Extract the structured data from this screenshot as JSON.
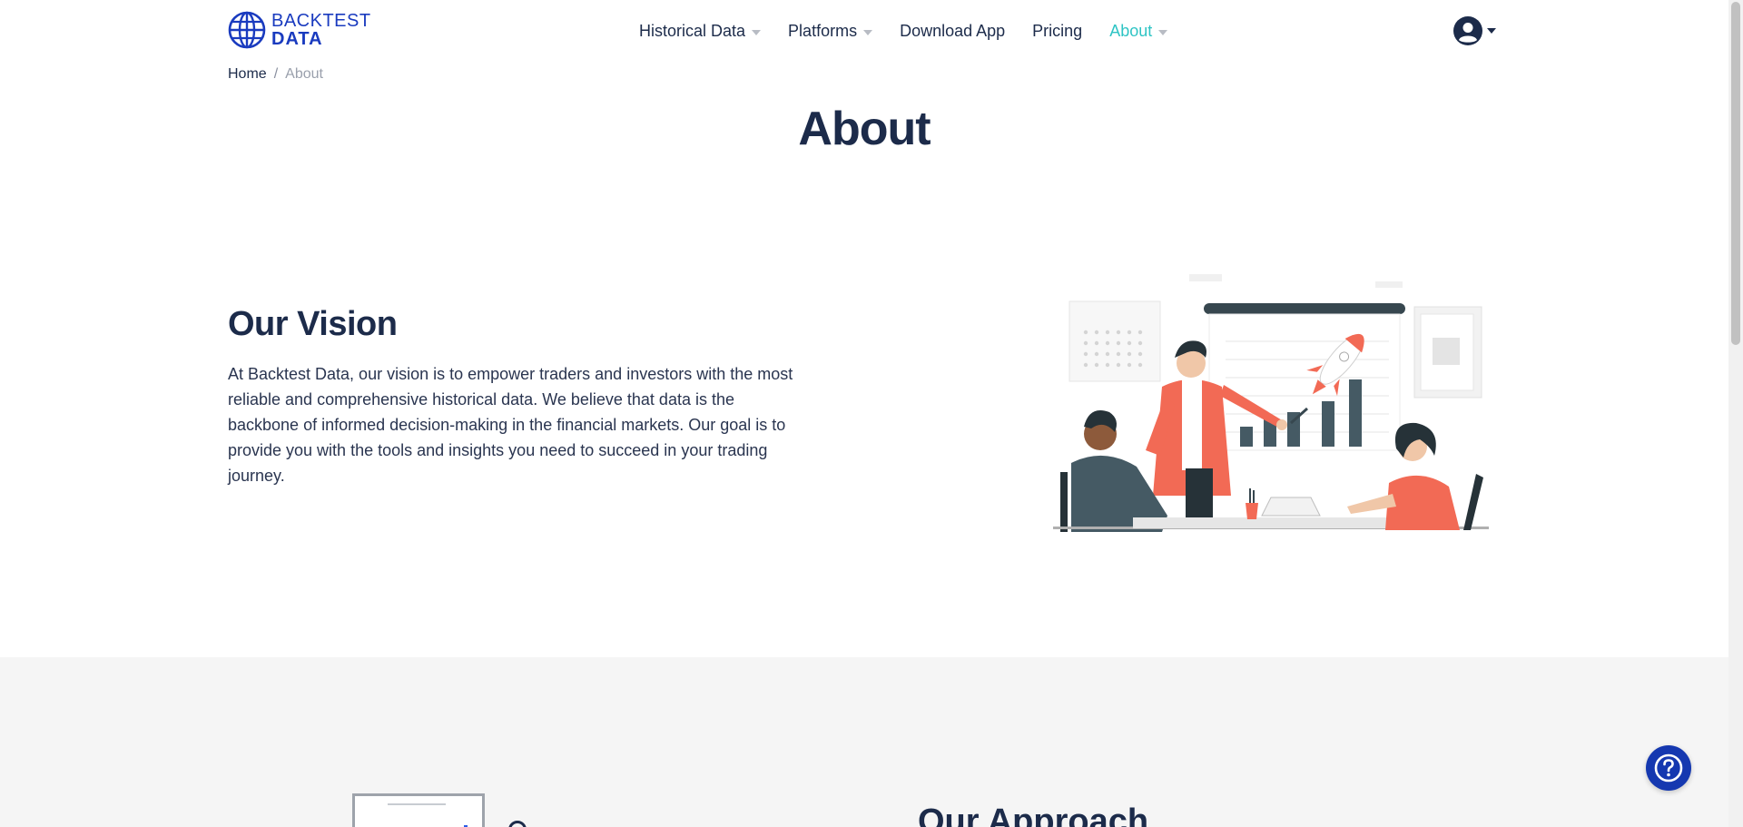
{
  "header": {
    "logo": {
      "line1": "BACKTEST",
      "line2": "DATA"
    },
    "nav": [
      {
        "label": "Historical Data",
        "has_dropdown": true,
        "active": false
      },
      {
        "label": "Platforms",
        "has_dropdown": true,
        "active": false
      },
      {
        "label": "Download App",
        "has_dropdown": false,
        "active": false
      },
      {
        "label": "Pricing",
        "has_dropdown": false,
        "active": false
      },
      {
        "label": "About",
        "has_dropdown": true,
        "active": true
      }
    ],
    "account_icon": "user-circle-icon"
  },
  "breadcrumb": {
    "home": "Home",
    "separator": "/",
    "current": "About"
  },
  "page_title": "About",
  "vision": {
    "title": "Our Vision",
    "text": "At Backtest Data, our vision is to empower traders and investors with the most reliable and comprehensive historical data. We believe that data is the backbone of informed decision-making in the financial markets. Our goal is to provide you with the tools and insights you need to succeed in your trading journey."
  },
  "approach": {
    "title": "Our Approach"
  },
  "help_icon": "question-circle-icon",
  "colors": {
    "brand_blue": "#1a3bbf",
    "navy_text": "#1c2b4a",
    "active_teal": "#2ec4c4",
    "accent_coral": "#f26a55",
    "help_button": "#1538b0"
  }
}
